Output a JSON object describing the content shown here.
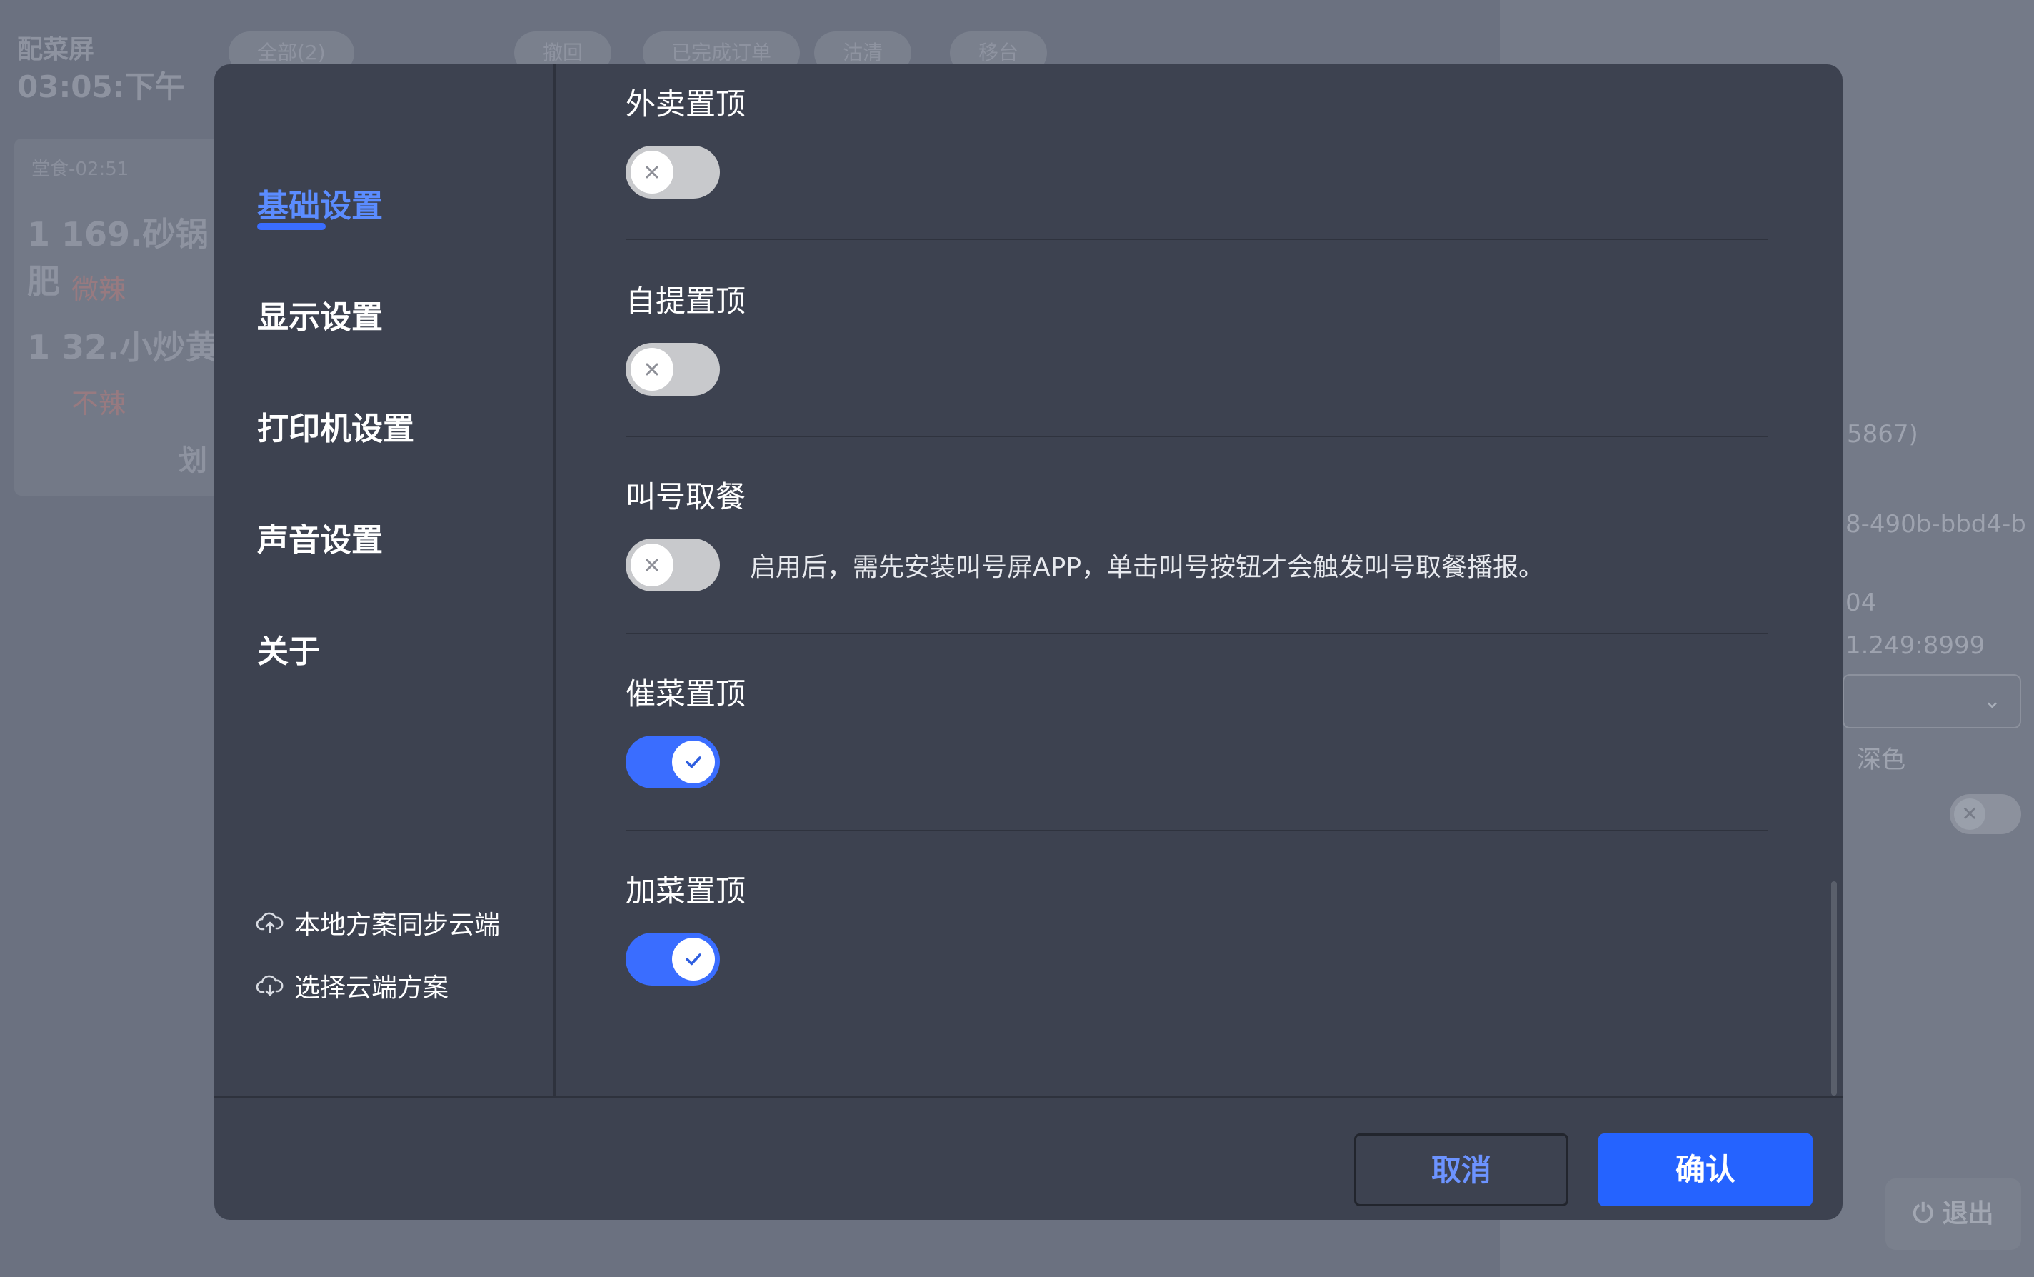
{
  "background": {
    "app_title": "配菜屏",
    "time": "03:05:下午",
    "toolbar": [
      "全部(2)",
      "撤回",
      "已完成订单",
      "沽清",
      "移台"
    ],
    "card": {
      "header": "堂食-02:51",
      "items": [
        {
          "qty": "1",
          "name": "169.砂锅肥",
          "note": "微辣"
        },
        {
          "qty": "1",
          "name": "32.小炒黄",
          "note": "不辣"
        }
      ],
      "footer": "划"
    },
    "right_panel": {
      "line1": "5867)",
      "line2": "8-490b-bbd4-b",
      "line3": "04",
      "line4": "1.249:8999",
      "theme": "深色",
      "exit_label": "退出"
    }
  },
  "sidebar": {
    "items": [
      {
        "label": "基础设置",
        "active": true
      },
      {
        "label": "显示设置",
        "active": false
      },
      {
        "label": "打印机设置",
        "active": false
      },
      {
        "label": "声音设置",
        "active": false
      },
      {
        "label": "关于",
        "active": false
      }
    ],
    "links": [
      {
        "label": "本地方案同步云端",
        "icon": "cloud-upload-icon"
      },
      {
        "label": "选择云端方案",
        "icon": "cloud-download-icon"
      }
    ]
  },
  "settings": [
    {
      "label": "外卖置顶",
      "enabled": false,
      "description": ""
    },
    {
      "label": "自提置顶",
      "enabled": false,
      "description": ""
    },
    {
      "label": "叫号取餐",
      "enabled": false,
      "description": "启用后，需先安装叫号屏APP，单击叫号按钮才会触发叫号取餐播报。"
    },
    {
      "label": "催菜置顶",
      "enabled": true,
      "description": ""
    },
    {
      "label": "加菜置顶",
      "enabled": true,
      "description": ""
    }
  ],
  "footer": {
    "cancel_label": "取消",
    "confirm_label": "确认"
  },
  "colors": {
    "accent": "#2563ff",
    "active_nav": "#5b8cff",
    "dialog_bg": "#3d4250",
    "toggle_off": "#c8c9cc"
  }
}
